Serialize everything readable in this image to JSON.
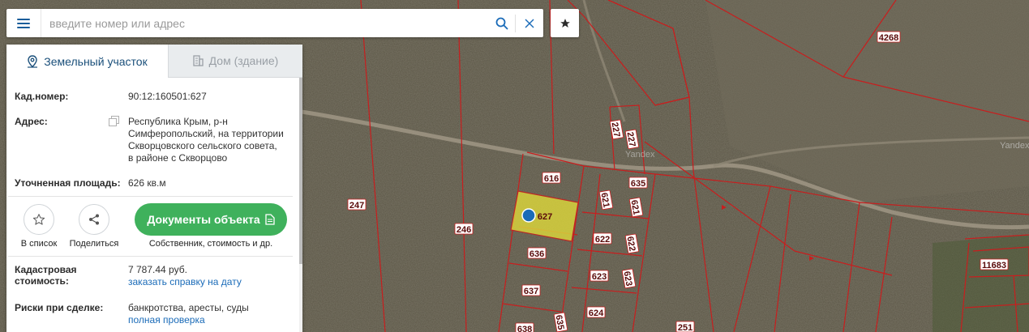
{
  "search": {
    "placeholder": "введите номер или адрес",
    "menu_icon": "hamburger-menu-icon",
    "search_icon": "magnifier-icon",
    "clear_icon": "close-icon",
    "favorite_icon": "star-icon"
  },
  "tabs": [
    {
      "label": "Земельный участок",
      "icon": "map-pin-icon",
      "active": true
    },
    {
      "label": "Дом (здание)",
      "icon": "building-icon",
      "active": false
    }
  ],
  "info": {
    "cad_label": "Кад.номер:",
    "cad_value": "90:12:160501:627",
    "address_label": "Адрес:",
    "address_lines": [
      "Республика Крым, р-н",
      "Симферопольский, на территории",
      "Скворцовского сельского совета,",
      "в районе с Скворцово"
    ],
    "area_label": "Уточненная площадь:",
    "area_value": "626 кв.м",
    "cost_label_1": "Кадастровая",
    "cost_label_2": "стоимость:",
    "cost_value": "7 787.44 руб.",
    "cost_link": "заказать справку на дату",
    "risks_label": "Риски при сделке:",
    "risks_value": "банкротства, аресты, суды",
    "risks_link": "полная проверка"
  },
  "actions": {
    "favorite_label": "В список",
    "share_label": "Поделиться",
    "docs_button": "Документы объекта",
    "docs_subtitle": "Собственник, стоимость и др."
  },
  "map": {
    "plot_labels": {
      "p4268": "4268",
      "p227a": "227",
      "p227b": "227",
      "p616": "616",
      "p635a": "635",
      "p247": "247",
      "p627": "627",
      "p621a": "621",
      "p621b": "621",
      "p246": "246",
      "p622a": "622",
      "p622b": "622",
      "p636": "636",
      "p623a": "623",
      "p623b": "623",
      "p637": "637",
      "p624": "624",
      "p635b": "635",
      "p638": "638",
      "p251": "251",
      "p11683": "11683"
    },
    "watermark_1": "Yandex",
    "watermark_2": "Yandex",
    "colors": {
      "boundary": "#c81e1e",
      "selected_fill": "#d4cf3a",
      "marker": "#1a6bb8"
    }
  }
}
